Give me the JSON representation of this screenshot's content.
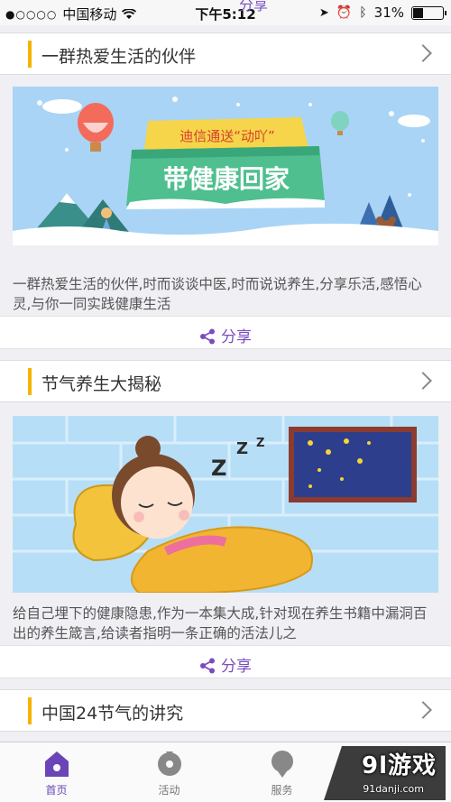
{
  "status_bar": {
    "carrier": "中国移动",
    "time": "下午5:12",
    "battery": "31%",
    "battery_level": 0.31
  },
  "peek_share": "分享",
  "articles": [
    {
      "title": "一群热爱生活的伙伴",
      "banner": {
        "badge_text": "迪信通送“动吖”",
        "headline": "带健康回家"
      },
      "description": "一群热爱生活的伙伴,时而谈谈中医,时而说说养生,分享乐活,感悟心灵,与你一同实践健康生活",
      "share_label": "分享"
    },
    {
      "title": "节气养生大揭秘",
      "description": "给自己埋下的健康隐患,作为一本集大成,针对现在养生书籍中漏洞百出的养生箴言,给读者指明一条正确的活法儿之",
      "share_label": "分享"
    },
    {
      "title": "中国24节气的讲究"
    }
  ],
  "tabs": [
    {
      "label": "首页",
      "icon": "home-icon",
      "active": true
    },
    {
      "label": "活动",
      "icon": "activity-icon",
      "active": false
    },
    {
      "label": "服务",
      "icon": "service-icon",
      "active": false
    }
  ],
  "watermark": {
    "logo": "9l游戏",
    "url": "91danji.com"
  },
  "colors": {
    "accent_bar": "#f5b400",
    "brand_purple": "#7a4cc0",
    "sky_blue": "#a9d4f5"
  }
}
